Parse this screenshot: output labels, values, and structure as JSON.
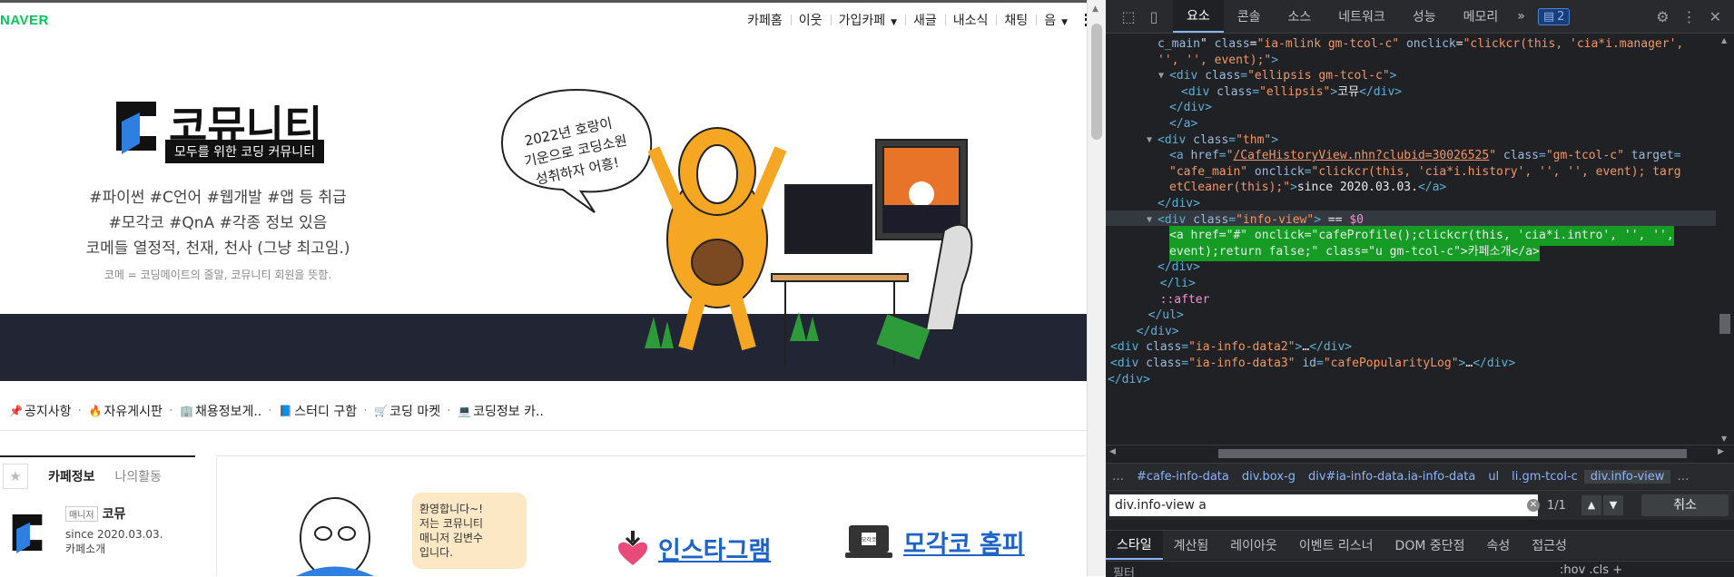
{
  "naver_logo": "NAVER",
  "topnav": {
    "items": [
      "카페홈",
      "이웃",
      "가입카페",
      "새글",
      "내소식",
      "채팅",
      "음"
    ]
  },
  "banner": {
    "brand_title": "코뮤니티",
    "brand_subtitle": "모두를 위한 코딩 커뮤니티",
    "tags_line1": "#파이썬 #C언어 #웹개발 #앱 등 취급",
    "tags_line2": "#모각코 #QnA #각종 정보 있음",
    "tags_line3": "코메들 열정적, 천재, 천사 (그냥 최고임.)",
    "tags_note": "코메 = 코딩메이트의 줄말, 코뮤니티 회원을 뜻함.",
    "speech": [
      "2022년 호랑이",
      "기운으로 코딩소원",
      "성취하자 어흥!"
    ]
  },
  "menu": {
    "items": [
      {
        "icon": "pin-icon",
        "label": "공지사항"
      },
      {
        "icon": "fire-icon",
        "label": "자유게시판"
      },
      {
        "icon": "building-icon",
        "label": "채용정보게.."
      },
      {
        "icon": "book-icon",
        "label": "스터디 구함"
      },
      {
        "icon": "cart-icon",
        "label": "코딩 마켓"
      },
      {
        "icon": "laptop-icon",
        "label": "코딩정보 카.."
      }
    ]
  },
  "sidebar": {
    "tab_info": "카페정보",
    "tab_activity": "나의활동",
    "role": "매니저",
    "name": "코뮤",
    "since": "since 2020.03.03.",
    "intro": "카페소개"
  },
  "promo": {
    "welcome": [
      "환영합니다~!",
      "저는 코뮤니티",
      "매니저 김변수",
      "입니다."
    ],
    "instagram": "인스타그램",
    "homepage": "모각코 홈피",
    "laptop_label": "모각코"
  },
  "devtools": {
    "tabs": [
      "요소",
      "콘솔",
      "소스",
      "네트워크",
      "성능",
      "메모리"
    ],
    "more": "»",
    "badge_count": "2",
    "code_lines": [
      {
        "indent": 1,
        "parts": [
          [
            "attr",
            "c_main"
          ],
          [
            "txt",
            "\" "
          ],
          [
            "attr",
            "class"
          ],
          [
            "txt",
            "="
          ],
          [
            "val",
            "\"ia-mlink gm-tcol-c\""
          ],
          [
            "txt",
            " "
          ],
          [
            "attr",
            "onclick"
          ],
          [
            "txt",
            "="
          ],
          [
            "val",
            "\"clickcr(this, 'cia*i.manager', "
          ]
        ]
      },
      {
        "indent": 1,
        "parts": [
          [
            "val",
            "'', '', event);\""
          ],
          [
            "tag",
            ">"
          ]
        ]
      },
      {
        "indent": 2,
        "tri": "▼",
        "parts": [
          [
            "tag",
            "<div "
          ],
          [
            "attr",
            "class"
          ],
          [
            "tag",
            "="
          ],
          [
            "val",
            "\"ellipsis gm-tcol-c\""
          ],
          [
            "tag",
            ">"
          ]
        ]
      },
      {
        "indent": 3,
        "parts": [
          [
            "tag",
            "<div "
          ],
          [
            "attr",
            "class"
          ],
          [
            "tag",
            "="
          ],
          [
            "val",
            "\"ellipsis\""
          ],
          [
            "tag",
            ">"
          ],
          [
            "txt",
            "코뮤"
          ],
          [
            "tag",
            "</div>"
          ]
        ]
      },
      {
        "indent": 2,
        "parts": [
          [
            "tag",
            "</div>"
          ]
        ]
      },
      {
        "indent": 2,
        "parts": [
          [
            "tag",
            "</a>"
          ]
        ]
      },
      {
        "indent": 1,
        "tri": "▼",
        "parts": [
          [
            "tag",
            "<div "
          ],
          [
            "attr",
            "class"
          ],
          [
            "tag",
            "="
          ],
          [
            "val",
            "\"thm\""
          ],
          [
            "tag",
            ">"
          ]
        ]
      },
      {
        "indent": 2,
        "parts": [
          [
            "tag",
            "<a "
          ],
          [
            "attr",
            "href"
          ],
          [
            "tag",
            "="
          ],
          [
            "val",
            "\""
          ],
          [
            "lnk",
            "/CafeHistoryView.nhn?clubid=30026525"
          ],
          [
            "val",
            "\""
          ],
          [
            "txt",
            " "
          ],
          [
            "attr",
            "class"
          ],
          [
            "tag",
            "="
          ],
          [
            "val",
            "\"gm-tcol-c\""
          ],
          [
            "txt",
            " "
          ],
          [
            "attr",
            "target"
          ],
          [
            "tag",
            "="
          ]
        ]
      },
      {
        "indent": 2,
        "parts": [
          [
            "val",
            "\"cafe_main\""
          ],
          [
            "txt",
            " "
          ],
          [
            "attr",
            "onclick"
          ],
          [
            "tag",
            "="
          ],
          [
            "val",
            "\"clickcr(this, 'cia*i.history', '', '', event); targ"
          ]
        ]
      },
      {
        "indent": 2,
        "parts": [
          [
            "val",
            "etCleaner(this);\""
          ],
          [
            "tag",
            ">"
          ],
          [
            "txt",
            "since 2020.03.03."
          ],
          [
            "tag",
            "</a>"
          ]
        ]
      },
      {
        "indent": 1,
        "parts": [
          [
            "tag",
            "</div>"
          ]
        ]
      },
      {
        "indent": 1,
        "tri": "▼",
        "sel": true,
        "parts": [
          [
            "tag",
            "<div "
          ],
          [
            "attr",
            "class"
          ],
          [
            "tag",
            "="
          ],
          [
            "val",
            "\"info-view\""
          ],
          [
            "tag",
            ">"
          ],
          [
            "txt",
            " == "
          ],
          [
            "pseudo",
            "$0"
          ]
        ]
      },
      {
        "indent": 2,
        "hl": true,
        "parts": [
          [
            "txt",
            "<a href=\"#\" onclick=\"cafeProfile();clickcr(this, 'cia*i.intro', '', '',"
          ]
        ]
      },
      {
        "indent": 2,
        "hl": true,
        "parts": [
          [
            "txt",
            "event);return false;\" class=\"u gm-tcol-c\">카페소개</a>"
          ]
        ]
      },
      {
        "indent": 1,
        "parts": [
          [
            "tag",
            "</div>"
          ]
        ]
      },
      {
        "indent": 0,
        "parts": [
          [
            "tag",
            "  </li>"
          ]
        ]
      },
      {
        "indent": 0,
        "parts": [
          [
            "pseudo",
            "  ::after"
          ]
        ]
      },
      {
        "indent": -1,
        "parts": [
          [
            "tag",
            "  </ul>"
          ]
        ]
      },
      {
        "indent": -2,
        "parts": [
          [
            "tag",
            "  </div>"
          ]
        ]
      },
      {
        "indent": -3,
        "tri": "▶",
        "parts": [
          [
            "tag",
            "<div "
          ],
          [
            "attr",
            "class"
          ],
          [
            "tag",
            "="
          ],
          [
            "val",
            "\"ia-info-data2\""
          ],
          [
            "tag",
            ">"
          ],
          [
            "txt",
            "…"
          ],
          [
            "tag",
            "</div>"
          ]
        ]
      },
      {
        "indent": -3,
        "tri": "▶",
        "parts": [
          [
            "tag",
            "<div "
          ],
          [
            "attr",
            "class"
          ],
          [
            "tag",
            "="
          ],
          [
            "val",
            "\"ia-info-data3\""
          ],
          [
            "txt",
            " "
          ],
          [
            "attr",
            "id"
          ],
          [
            "tag",
            "="
          ],
          [
            "val",
            "\"cafePopularityLog\""
          ],
          [
            "tag",
            ">"
          ],
          [
            "txt",
            "…"
          ],
          [
            "tag",
            "</div>"
          ]
        ]
      },
      {
        "indent": -4,
        "parts": [
          [
            "tag",
            "</div>"
          ]
        ]
      }
    ],
    "breadcrumbs": [
      "…",
      "#cafe-info-data",
      "div.box-g",
      "div#ia-info-data.ia-info-data",
      "ul",
      "li.gm-tcol-c",
      "div.info-view",
      "…"
    ],
    "search_value": "div.info-view a",
    "search_count": "1/1",
    "cancel_label": "취소",
    "bottom_tabs": [
      "스타일",
      "계산됨",
      "레이아웃",
      "이벤트 리스너",
      "DOM 중단점",
      "속성",
      "접근성"
    ],
    "filter_label": "필터",
    "filter_right": ":hov  .cls  +"
  }
}
